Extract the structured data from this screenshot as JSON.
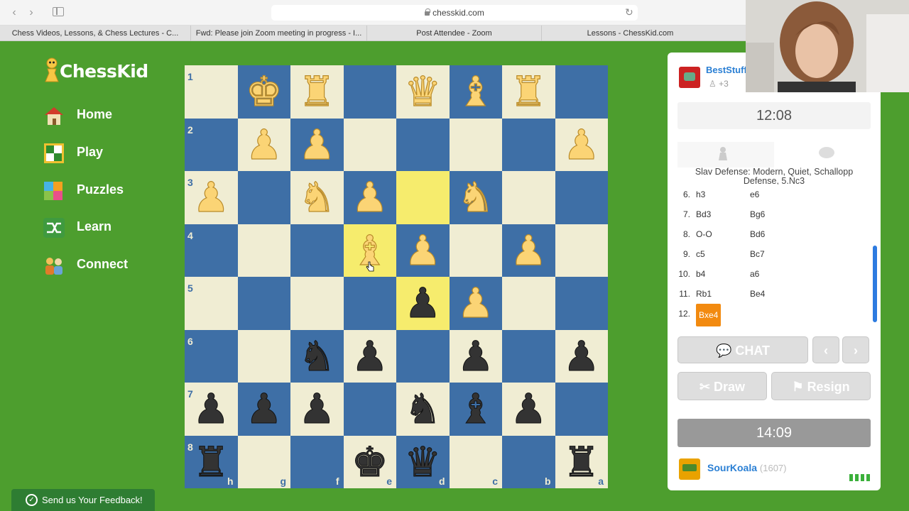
{
  "browser": {
    "url": "chesskid.com",
    "tabs": [
      "Chess Videos, Lessons, & Chess Lectures - C...",
      "Fwd: Please join Zoom meeting in progress - I...",
      "Post Attendee - Zoom",
      "Lessons - ChessKid.com"
    ]
  },
  "logo": {
    "text": "ChessKid"
  },
  "nav": [
    {
      "label": "Home",
      "icon": "house-icon"
    },
    {
      "label": "Play",
      "icon": "board-icon"
    },
    {
      "label": "Puzzles",
      "icon": "puzzle-icon"
    },
    {
      "label": "Learn",
      "icon": "shuffle-icon"
    },
    {
      "label": "Connect",
      "icon": "friends-icon"
    }
  ],
  "board": {
    "orientation": "black",
    "rank_labels": [
      "1",
      "2",
      "3",
      "4",
      "5",
      "6",
      "7",
      "8"
    ],
    "file_labels": [
      "h",
      "g",
      "f",
      "e",
      "d",
      "c",
      "b",
      "a"
    ],
    "rows": [
      [
        null,
        "wK",
        "wR",
        null,
        "wQ",
        "wB",
        "wR",
        null
      ],
      [
        null,
        "wP",
        "wP",
        null,
        null,
        null,
        null,
        "wP"
      ],
      [
        "wP",
        null,
        "wN",
        "wP",
        null,
        "wN",
        null,
        null
      ],
      [
        null,
        null,
        null,
        "wB",
        "wP",
        null,
        "wP",
        null
      ],
      [
        null,
        null,
        null,
        null,
        "bP",
        "wP",
        null,
        null
      ],
      [
        null,
        null,
        "bN",
        "bP",
        null,
        "bP",
        null,
        "bP"
      ],
      [
        "bP",
        "bP",
        "bP",
        null,
        "bN",
        "bB",
        "bP",
        null
      ],
      [
        "bR",
        null,
        null,
        "bK",
        "bQ",
        null,
        null,
        "bR"
      ]
    ],
    "highlights": [
      [
        2,
        4
      ],
      [
        3,
        3
      ],
      [
        4,
        4
      ]
    ],
    "colors": {
      "light": "#f0edd3",
      "dark": "#3e6fa6",
      "highlight": "#f6ec6d"
    }
  },
  "opponent": {
    "name": "BestStuff",
    "captured": "+3"
  },
  "clocks": {
    "opponent": "12:08",
    "me": "14:09"
  },
  "opening": "Slav Defense: Modern, Quiet, Schallopp Defense, 5.Nc3",
  "moves": [
    {
      "num": "6.",
      "white": "h3",
      "black": "e6"
    },
    {
      "num": "7.",
      "white": "Bd3",
      "black": "Bg6"
    },
    {
      "num": "8.",
      "white": "O-O",
      "black": "Bd6"
    },
    {
      "num": "9.",
      "white": "c5",
      "black": "Bc7"
    },
    {
      "num": "10.",
      "white": "b4",
      "black": "a6"
    },
    {
      "num": "11.",
      "white": "Rb1",
      "black": "Be4"
    },
    {
      "num": "12.",
      "white": "Bxe4",
      "black": ""
    }
  ],
  "buttons": {
    "chat": "CHAT",
    "prev": "‹",
    "next": "›",
    "draw": "Draw",
    "resign": "Resign"
  },
  "me": {
    "name": "SourKoala",
    "rating": "(1607)"
  },
  "feedback": {
    "label": "Send us Your Feedback!"
  }
}
